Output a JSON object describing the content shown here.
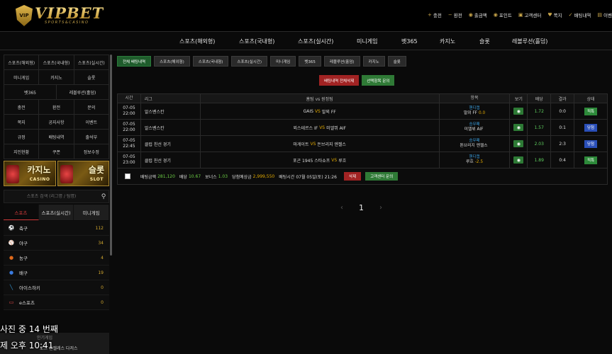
{
  "logo": {
    "mark": "VIP",
    "main": "VIPBET",
    "sub": "SPORTS&CASINO"
  },
  "top_links": [
    {
      "icon": "+",
      "label": "충전"
    },
    {
      "icon": "−",
      "label": "환전"
    },
    {
      "icon": "◉",
      "label": "출금액"
    },
    {
      "icon": "◉",
      "label": "포인트"
    },
    {
      "icon": "▣",
      "label": "고객센터"
    },
    {
      "icon": "♥",
      "label": "쪽지"
    },
    {
      "icon": "✓",
      "label": "배팅내역"
    },
    {
      "icon": "▤",
      "label": "이벤"
    }
  ],
  "main_nav": [
    "스포츠(해외형)",
    "스포츠(국내형)",
    "스포츠(실시간)",
    "미니게임",
    "벳365",
    "카지노",
    "슬롯",
    "레볼루션(홀덤)"
  ],
  "sidebar": {
    "grid3a": [
      "스포츠(해외형)",
      "스포츠(국내형)",
      "스포츠(실시간)",
      "미니게임",
      "카지노",
      "슬롯"
    ],
    "grid2": [
      "벳365",
      "레볼루션(홀덤)"
    ],
    "grid3b": [
      "충전",
      "환전",
      "문의",
      "쪽지",
      "공지사항",
      "이벤트",
      "규정",
      "배팅내역",
      "출석부",
      "지인현황",
      "쿠폰",
      "정보수정"
    ],
    "banners": [
      {
        "title": "카지노",
        "sub": "CASINO"
      },
      {
        "title": "슬롯",
        "sub": "SLOT"
      }
    ],
    "search_placeholder": "스포츠 검색 (리그명 / 팀명)",
    "sport_tabs": [
      "스포츠",
      "스포츠(실시간)",
      "미니게임"
    ],
    "sports": [
      {
        "icon": "⚽",
        "color": "#ffffff",
        "name": "축구",
        "count": "112"
      },
      {
        "icon": "⚾",
        "color": "#ffffff",
        "name": "야구",
        "count": "34"
      },
      {
        "icon": "●",
        "color": "#e06a1b",
        "name": "농구",
        "count": "4"
      },
      {
        "icon": "●",
        "color": "#3a7be0",
        "name": "배구",
        "count": "19"
      },
      {
        "icon": "╲",
        "color": "#3aa0e0",
        "name": "아이스하키",
        "count": "0"
      },
      {
        "icon": "▭",
        "color": "#e04a4a",
        "name": "e스포츠",
        "count": "0"
      }
    ],
    "bottom": {
      "line1": "인기게임",
      "line2": "토스 엔젤레스 다저스"
    }
  },
  "overlay": {
    "line1": "사진 중 14 번째",
    "line2": "제 오후 10:41"
  },
  "filters": [
    "전체 배팅내역",
    "스포츠(해외형)",
    "스포츠(국내형)",
    "스포츠(실시간)",
    "미니게임",
    "벳365",
    "레볼루션(홀덤)",
    "카지노",
    "슬롯"
  ],
  "actions": {
    "delete_all": "배팅내역 전체삭제",
    "ask": "선택항목 문의"
  },
  "table": {
    "headers": [
      "시간",
      "리그",
      "홈팀 vs 원정팀",
      "항목",
      "보기",
      "배당",
      "결과",
      "상태"
    ],
    "rows": [
      {
        "date": "07-05",
        "time": "22:00",
        "league": "알스벤스칸",
        "home": "GAIS",
        "vs": "VS",
        "away": "말뫼 FF",
        "pick_type": "핸디캡",
        "pick": "말뫼 FF",
        "pick_val": "0.0",
        "odds": "1.72",
        "result": "0:0",
        "status": "적특",
        "status_kind": "hit"
      },
      {
        "date": "07-05",
        "time": "22:00",
        "league": "알스벤스칸",
        "home": "외스테르스 IF",
        "vs": "VS",
        "away": "미엘뷔 AIF",
        "pick_type": "승무패",
        "pick": "미엘뷔 AIF",
        "pick_val": "",
        "odds": "1.57",
        "result": "0:1",
        "status": "당첨",
        "status_kind": "pend"
      },
      {
        "date": "07-05",
        "time": "22:45",
        "league": "클럽 친선 경기",
        "home": "마게이트",
        "vs": "VS",
        "away": "돈브리지 엔젤스",
        "pick_type": "승무패",
        "pick": "톤브리지 엔젤스",
        "pick_val": "",
        "odds": "2.03",
        "result": "2:3",
        "status": "당첨",
        "status_kind": "pend"
      },
      {
        "date": "07-05",
        "time": "23:00",
        "league": "클럽 친선 경기",
        "home": "포곤 1945 스타쇼프",
        "vs": "VS",
        "away": "루흐",
        "pick_type": "핸디캡",
        "pick": "루흐",
        "pick_val": "-2.5",
        "odds": "1.89",
        "result": "0:4",
        "status": "적특",
        "status_kind": "hit"
      }
    ]
  },
  "summary": {
    "bet_amount_label": "배팅금액",
    "bet_amount": "281,120",
    "odds_label": "배당",
    "odds": "10.67",
    "bonus_label": "보너스",
    "bonus": "1.03",
    "expected_label": "당첨예상금",
    "expected": "2,999,550",
    "time_label": "배팅시간",
    "time": "07월 05일(토) 21:26",
    "delete": "삭제",
    "ask": "고객센터 문의"
  },
  "pagination": {
    "prev": "‹",
    "current": "1",
    "next": "›"
  }
}
